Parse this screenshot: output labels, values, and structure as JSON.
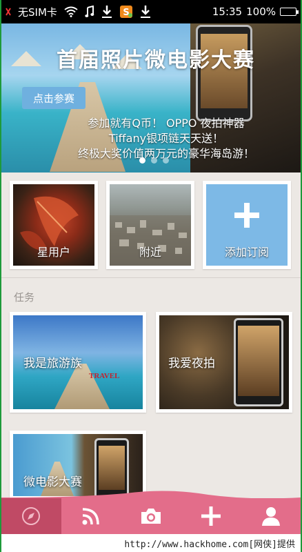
{
  "status_bar": {
    "carrier": "无SIM卡",
    "time": "15:35",
    "battery": "100%",
    "icons": [
      "wifi-icon",
      "music-icon",
      "download-icon",
      "sogou-input-icon",
      "download-icon",
      "battery-icon"
    ]
  },
  "banner": {
    "title": "首届照片微电影大赛",
    "button": "点击参赛",
    "lines": [
      "参加就有Q币！ OPPO 夜拍神器",
      "Tiffany银项链天天送！",
      "终极大奖价值两万元的豪华海岛游！"
    ],
    "page_count": 3,
    "active_index": 0
  },
  "subscriptions": [
    {
      "label": "星用户",
      "image": "autumn-leaf-photo"
    },
    {
      "label": "附近",
      "image": "city-aerial-photo"
    },
    {
      "label": "添加订阅",
      "icon": "plus-icon"
    }
  ],
  "tasks_section": {
    "label": "任务",
    "items": [
      {
        "label": "我是旅游族",
        "image": "island-resort-photo",
        "overlay_text": "TRAVEL"
      },
      {
        "label": "我爱夜拍",
        "image": "night-phone-photo"
      },
      {
        "label": "微电影大赛",
        "image": "movie-contest-photo"
      }
    ]
  },
  "bottom_nav": [
    {
      "icon": "compass-icon",
      "active": true
    },
    {
      "icon": "rss-feed-icon",
      "active": false
    },
    {
      "icon": "camera-icon",
      "active": false
    },
    {
      "icon": "plus-icon",
      "active": false
    },
    {
      "icon": "user-icon",
      "active": false
    }
  ],
  "watermark": "http://www.hackhome.com[网侠]提供",
  "colors": {
    "nav_bg": "#e36d8a",
    "nav_active": "#c04a65",
    "button_blue": "#6fb0df",
    "add_tile": "#7db9e6"
  }
}
